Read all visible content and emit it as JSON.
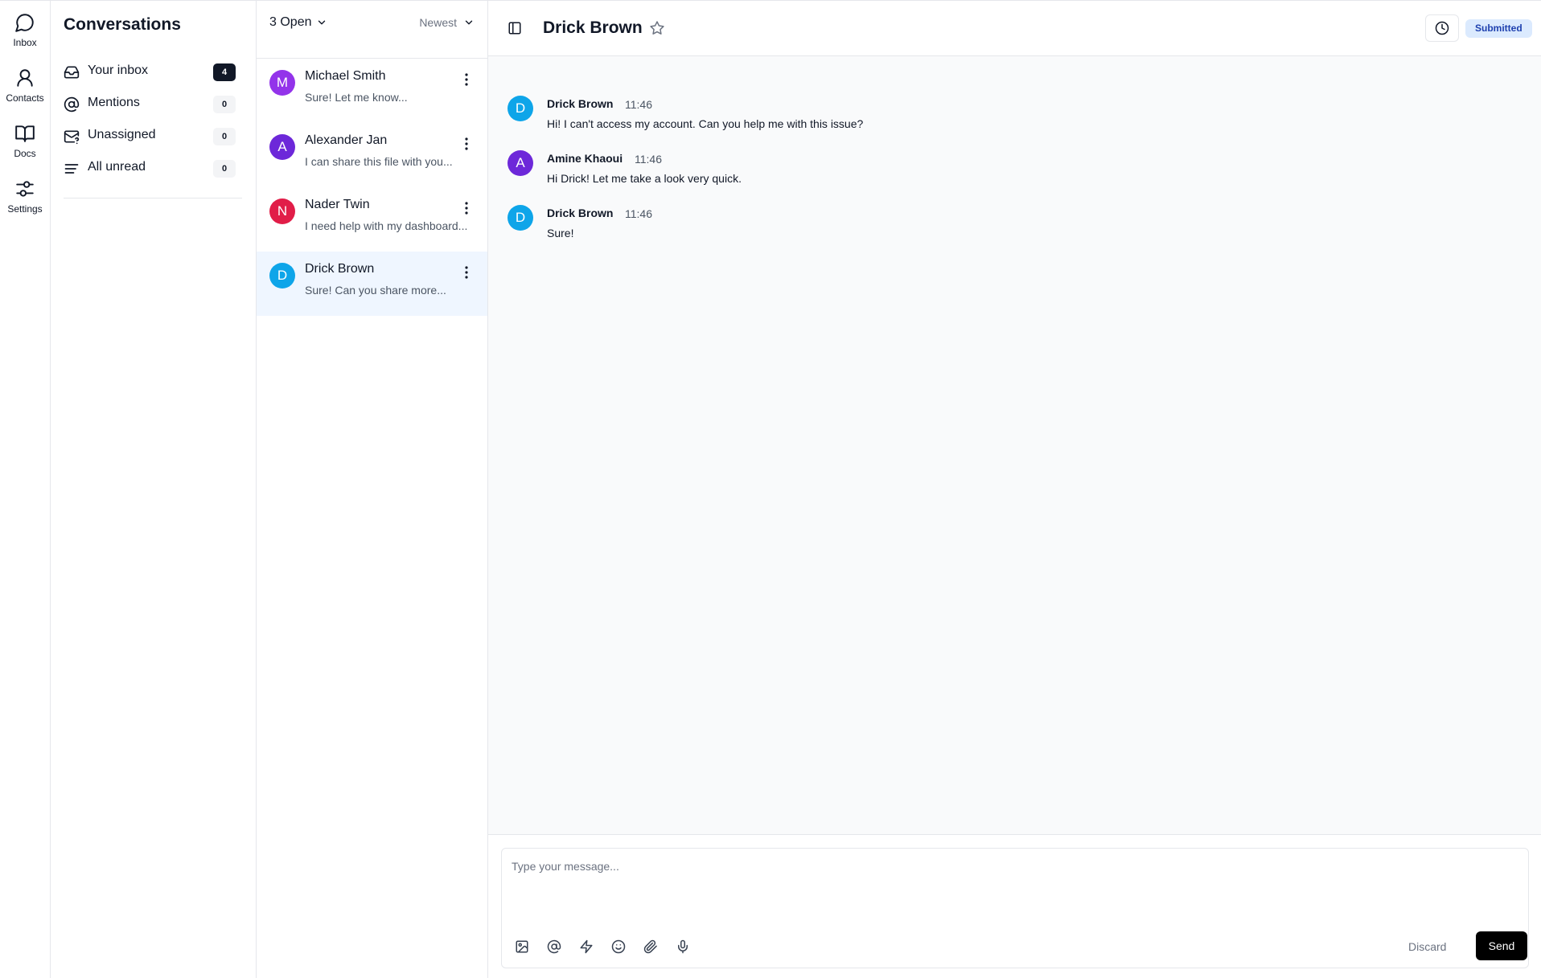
{
  "rail": {
    "items": [
      {
        "label": "Inbox",
        "icon": "chat-bubble-icon"
      },
      {
        "label": "Contacts",
        "icon": "user-icon"
      },
      {
        "label": "Docs",
        "icon": "book-icon"
      },
      {
        "label": "Settings",
        "icon": "sliders-icon"
      }
    ]
  },
  "sidebar": {
    "title": "Conversations",
    "items": [
      {
        "label": "Your inbox",
        "count": "4",
        "icon": "inbox-icon",
        "highlight": true
      },
      {
        "label": "Mentions",
        "count": "0",
        "icon": "at-sign-icon"
      },
      {
        "label": "Unassigned",
        "count": "0",
        "icon": "mail-question-icon"
      },
      {
        "label": "All unread",
        "count": "0",
        "icon": "lines-icon"
      }
    ]
  },
  "list": {
    "filter_label": "3 Open",
    "sort_label": "Newest",
    "conversations": [
      {
        "initial": "M",
        "name": "Michael Smith",
        "preview": "Sure! Let me know...",
        "color": "#9333ea"
      },
      {
        "initial": "A",
        "name": "Alexander Jan",
        "preview": "I can share this file with you...",
        "color": "#6d28d9"
      },
      {
        "initial": "N",
        "name": "Nader Twin",
        "preview": "I need help with my dashboard...",
        "color": "#e11d48"
      },
      {
        "initial": "D",
        "name": "Drick Brown",
        "preview": "Sure! Can you share more...",
        "color": "#0ea5e9",
        "active": true
      }
    ]
  },
  "chat": {
    "title": "Drick Brown",
    "status": "Submitted",
    "messages": [
      {
        "initial": "D",
        "author": "Drick Brown",
        "time": "11:46",
        "text": "Hi! I can't access my account. Can you help me with this issue?",
        "color": "#0ea5e9"
      },
      {
        "initial": "A",
        "author": "Amine Khaoui",
        "time": "11:46",
        "text": "Hi Drick! Let me take a look very quick.",
        "color": "#6d28d9"
      },
      {
        "initial": "D",
        "author": "Drick Brown",
        "time": "11:46",
        "text": "Sure!",
        "color": "#0ea5e9"
      }
    ],
    "composer": {
      "placeholder": "Type your message...",
      "value": "",
      "discard_label": "Discard",
      "send_label": "Send",
      "tools": [
        "image-icon",
        "at-sign-icon",
        "lightning-icon",
        "smile-icon",
        "paperclip-icon",
        "microphone-icon"
      ]
    }
  },
  "colors": {
    "accent": "#000000",
    "badge_bg": "#dbeafe",
    "badge_text": "#1e40af",
    "active_row": "#eff6ff"
  }
}
